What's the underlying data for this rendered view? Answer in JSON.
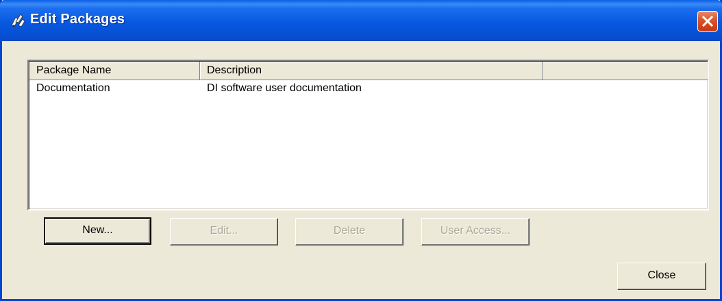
{
  "window": {
    "title": "Edit Packages",
    "icon": "package-tools-icon"
  },
  "list": {
    "columns": [
      "Package Name",
      "Description",
      ""
    ],
    "rows": [
      {
        "name": "Documentation",
        "description": "DI software user documentation"
      }
    ]
  },
  "buttons": {
    "new": "New...",
    "edit": "Edit...",
    "delete": "Delete",
    "user_access": "User Access...",
    "close": "Close"
  },
  "colors": {
    "titlebar": "#0758e0",
    "close_button": "#d9542b",
    "dialog_bg": "#ece9d8",
    "disabled_text": "#aca899"
  }
}
